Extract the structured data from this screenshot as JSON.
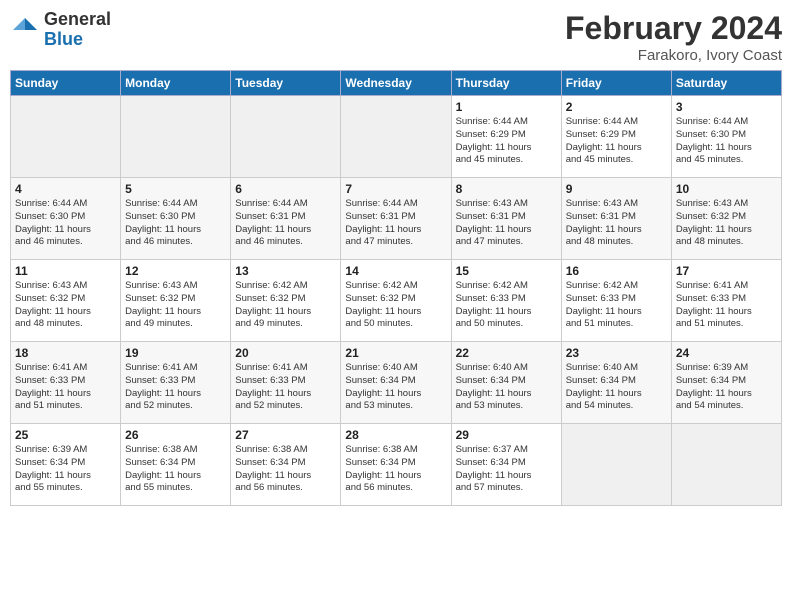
{
  "header": {
    "logo_general": "General",
    "logo_blue": "Blue",
    "title": "February 2024",
    "subtitle": "Farakoro, Ivory Coast"
  },
  "days_of_week": [
    "Sunday",
    "Monday",
    "Tuesday",
    "Wednesday",
    "Thursday",
    "Friday",
    "Saturday"
  ],
  "weeks": [
    [
      {
        "day": "",
        "info": ""
      },
      {
        "day": "",
        "info": ""
      },
      {
        "day": "",
        "info": ""
      },
      {
        "day": "",
        "info": ""
      },
      {
        "day": "1",
        "info": "Sunrise: 6:44 AM\nSunset: 6:29 PM\nDaylight: 11 hours\nand 45 minutes."
      },
      {
        "day": "2",
        "info": "Sunrise: 6:44 AM\nSunset: 6:29 PM\nDaylight: 11 hours\nand 45 minutes."
      },
      {
        "day": "3",
        "info": "Sunrise: 6:44 AM\nSunset: 6:30 PM\nDaylight: 11 hours\nand 45 minutes."
      }
    ],
    [
      {
        "day": "4",
        "info": "Sunrise: 6:44 AM\nSunset: 6:30 PM\nDaylight: 11 hours\nand 46 minutes."
      },
      {
        "day": "5",
        "info": "Sunrise: 6:44 AM\nSunset: 6:30 PM\nDaylight: 11 hours\nand 46 minutes."
      },
      {
        "day": "6",
        "info": "Sunrise: 6:44 AM\nSunset: 6:31 PM\nDaylight: 11 hours\nand 46 minutes."
      },
      {
        "day": "7",
        "info": "Sunrise: 6:44 AM\nSunset: 6:31 PM\nDaylight: 11 hours\nand 47 minutes."
      },
      {
        "day": "8",
        "info": "Sunrise: 6:43 AM\nSunset: 6:31 PM\nDaylight: 11 hours\nand 47 minutes."
      },
      {
        "day": "9",
        "info": "Sunrise: 6:43 AM\nSunset: 6:31 PM\nDaylight: 11 hours\nand 48 minutes."
      },
      {
        "day": "10",
        "info": "Sunrise: 6:43 AM\nSunset: 6:32 PM\nDaylight: 11 hours\nand 48 minutes."
      }
    ],
    [
      {
        "day": "11",
        "info": "Sunrise: 6:43 AM\nSunset: 6:32 PM\nDaylight: 11 hours\nand 48 minutes."
      },
      {
        "day": "12",
        "info": "Sunrise: 6:43 AM\nSunset: 6:32 PM\nDaylight: 11 hours\nand 49 minutes."
      },
      {
        "day": "13",
        "info": "Sunrise: 6:42 AM\nSunset: 6:32 PM\nDaylight: 11 hours\nand 49 minutes."
      },
      {
        "day": "14",
        "info": "Sunrise: 6:42 AM\nSunset: 6:32 PM\nDaylight: 11 hours\nand 50 minutes."
      },
      {
        "day": "15",
        "info": "Sunrise: 6:42 AM\nSunset: 6:33 PM\nDaylight: 11 hours\nand 50 minutes."
      },
      {
        "day": "16",
        "info": "Sunrise: 6:42 AM\nSunset: 6:33 PM\nDaylight: 11 hours\nand 51 minutes."
      },
      {
        "day": "17",
        "info": "Sunrise: 6:41 AM\nSunset: 6:33 PM\nDaylight: 11 hours\nand 51 minutes."
      }
    ],
    [
      {
        "day": "18",
        "info": "Sunrise: 6:41 AM\nSunset: 6:33 PM\nDaylight: 11 hours\nand 51 minutes."
      },
      {
        "day": "19",
        "info": "Sunrise: 6:41 AM\nSunset: 6:33 PM\nDaylight: 11 hours\nand 52 minutes."
      },
      {
        "day": "20",
        "info": "Sunrise: 6:41 AM\nSunset: 6:33 PM\nDaylight: 11 hours\nand 52 minutes."
      },
      {
        "day": "21",
        "info": "Sunrise: 6:40 AM\nSunset: 6:34 PM\nDaylight: 11 hours\nand 53 minutes."
      },
      {
        "day": "22",
        "info": "Sunrise: 6:40 AM\nSunset: 6:34 PM\nDaylight: 11 hours\nand 53 minutes."
      },
      {
        "day": "23",
        "info": "Sunrise: 6:40 AM\nSunset: 6:34 PM\nDaylight: 11 hours\nand 54 minutes."
      },
      {
        "day": "24",
        "info": "Sunrise: 6:39 AM\nSunset: 6:34 PM\nDaylight: 11 hours\nand 54 minutes."
      }
    ],
    [
      {
        "day": "25",
        "info": "Sunrise: 6:39 AM\nSunset: 6:34 PM\nDaylight: 11 hours\nand 55 minutes."
      },
      {
        "day": "26",
        "info": "Sunrise: 6:38 AM\nSunset: 6:34 PM\nDaylight: 11 hours\nand 55 minutes."
      },
      {
        "day": "27",
        "info": "Sunrise: 6:38 AM\nSunset: 6:34 PM\nDaylight: 11 hours\nand 56 minutes."
      },
      {
        "day": "28",
        "info": "Sunrise: 6:38 AM\nSunset: 6:34 PM\nDaylight: 11 hours\nand 56 minutes."
      },
      {
        "day": "29",
        "info": "Sunrise: 6:37 AM\nSunset: 6:34 PM\nDaylight: 11 hours\nand 57 minutes."
      },
      {
        "day": "",
        "info": ""
      },
      {
        "day": "",
        "info": ""
      }
    ]
  ]
}
